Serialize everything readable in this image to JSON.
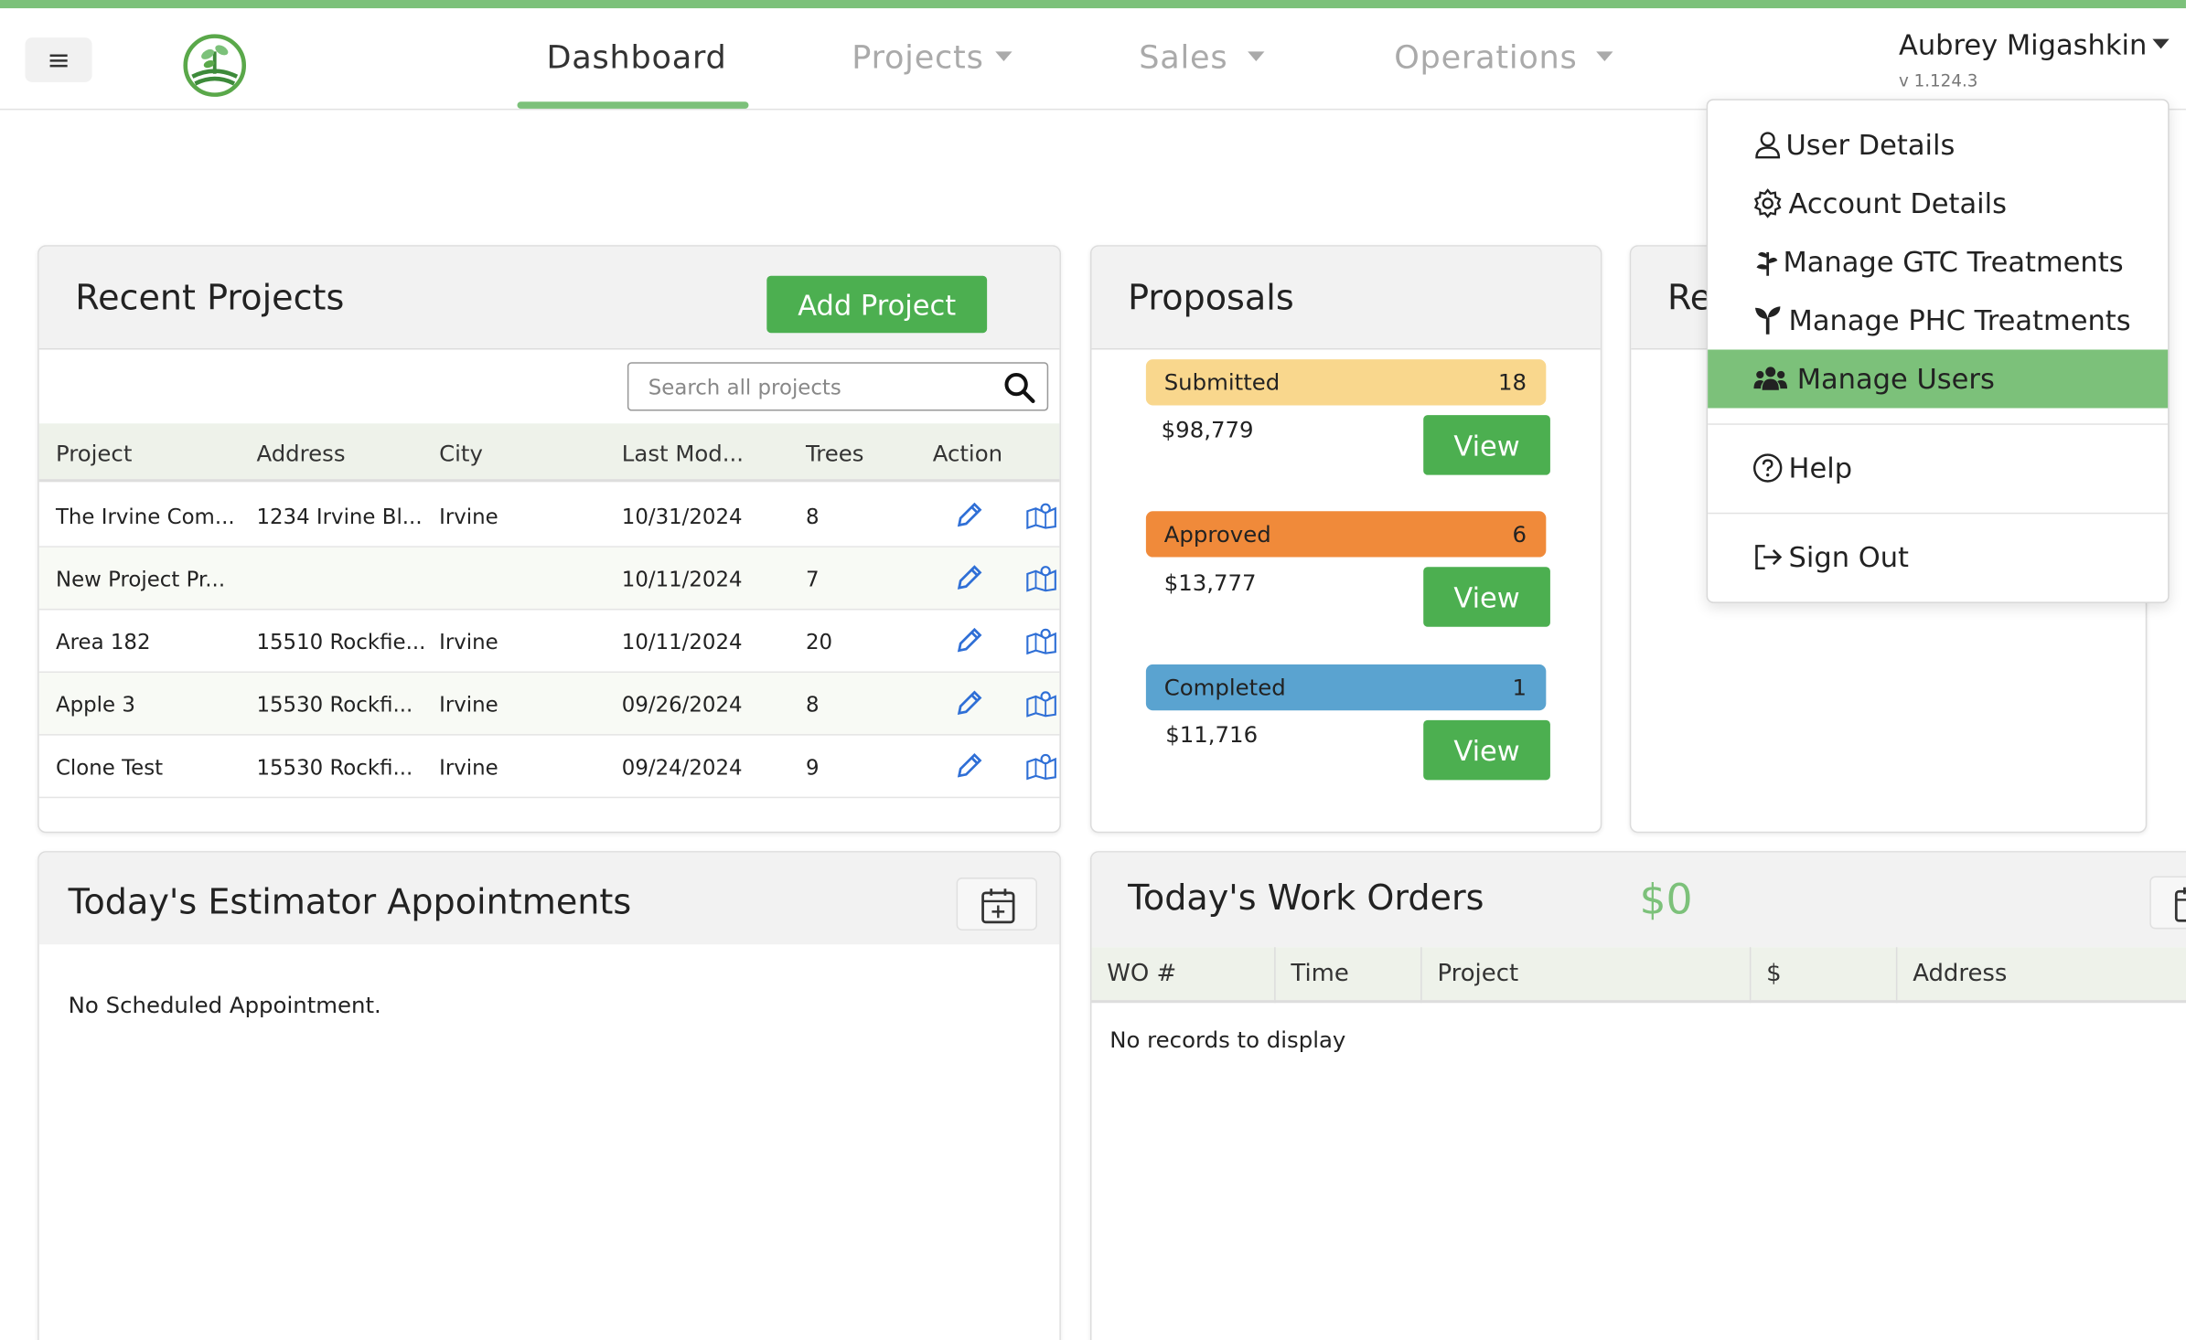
{
  "nav": {
    "menu_glyph": "≡",
    "tabs": [
      {
        "label": "Dashboard",
        "active": true
      },
      {
        "label": "Projects",
        "dropdown": true
      },
      {
        "label": "Sales",
        "dropdown": true
      },
      {
        "label": "Operations",
        "dropdown": true
      }
    ],
    "user_name": "Aubrey Migashkin",
    "version": "v 1.124.3"
  },
  "user_menu": {
    "items": [
      {
        "label": "User Details",
        "icon": "person-icon"
      },
      {
        "label": "Account Details",
        "icon": "gear-icon"
      },
      {
        "label": "Manage GTC Treatments",
        "icon": "plant-icon"
      },
      {
        "label": "Manage PHC Treatments",
        "icon": "sprout-icon"
      },
      {
        "label": "Manage Users",
        "icon": "users-icon",
        "active": true
      },
      {
        "label": "Help",
        "icon": "question-circle-icon"
      },
      {
        "label": "Sign Out",
        "icon": "sign-out-icon"
      }
    ]
  },
  "recent_projects": {
    "title": "Recent Projects",
    "add_button": "Add Project",
    "search_placeholder": "Search all projects",
    "columns": [
      "Project",
      "Address",
      "City",
      "Last Mod...",
      "Trees",
      "Action"
    ],
    "rows": [
      {
        "project": "The Irvine Com...",
        "address": "1234 Irvine Bl...",
        "city": "Irvine",
        "modified": "10/31/2024",
        "trees": "8"
      },
      {
        "project": "New Project Pr...",
        "address": "",
        "city": "",
        "modified": "10/11/2024",
        "trees": "7"
      },
      {
        "project": "Area 182",
        "address": "15510 Rockfie...",
        "city": "Irvine",
        "modified": "10/11/2024",
        "trees": "20"
      },
      {
        "project": "Apple 3",
        "address": "15530 Rockfi...",
        "city": "Irvine",
        "modified": "09/26/2024",
        "trees": "8"
      },
      {
        "project": "Clone Test",
        "address": "15530 Rockfi...",
        "city": "Irvine",
        "modified": "09/24/2024",
        "trees": "9"
      }
    ]
  },
  "proposals": {
    "title": "Proposals",
    "groups": [
      {
        "label": "Submitted",
        "count": "18",
        "amount": "$98,779",
        "button": "View",
        "color": "#f9d78d"
      },
      {
        "label": "Approved",
        "count": "6",
        "amount": "$13,777",
        "button": "View",
        "color": "#f08a3a"
      },
      {
        "label": "Completed",
        "count": "1",
        "amount": "$11,716",
        "button": "View",
        "color": "#5aa3d0"
      }
    ]
  },
  "third_card": {
    "title_fragment": "Re"
  },
  "appointments": {
    "title": "Today's Estimator Appointments",
    "empty": "No Scheduled Appointment."
  },
  "work_orders": {
    "title": "Today's Work Orders",
    "total": "$0",
    "columns": [
      "WO #",
      "Time",
      "Project",
      "$",
      "Address"
    ],
    "empty": "No records to display"
  },
  "colors": {
    "accent": "#7cc17a",
    "button": "#4caf50",
    "total": "#7cc17a"
  }
}
